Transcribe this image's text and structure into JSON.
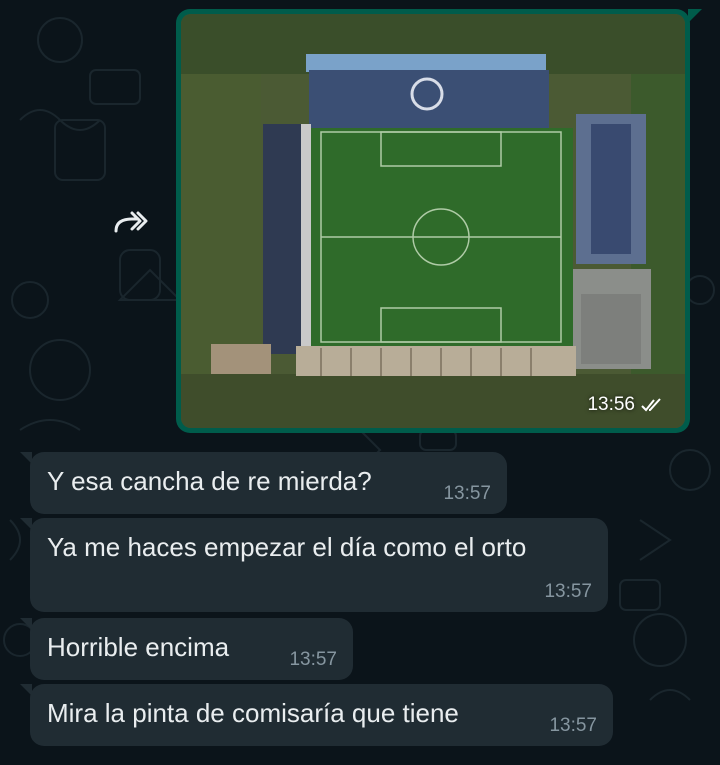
{
  "colors": {
    "background": "#0b141a",
    "incoming_bubble": "#202c33",
    "outgoing_bubble": "#005c4b",
    "text": "#e9edef",
    "meta_text": "#8696a0",
    "pitch_green": "#2f6b2a"
  },
  "forward": {
    "icon": "forward-icon"
  },
  "image_message": {
    "time": "13:56",
    "status_icon": "double-check-icon",
    "photo_description_icon": "stadium-aerial-photo"
  },
  "messages": [
    {
      "text": "Y esa cancha de re mierda?",
      "time": "13:57"
    },
    {
      "text": "Ya me haces empezar el día como el orto",
      "time": "13:57"
    },
    {
      "text": "Horrible encima",
      "time": "13:57"
    },
    {
      "text": "Mira la pinta de comisaría que tiene",
      "time": "13:57"
    }
  ]
}
